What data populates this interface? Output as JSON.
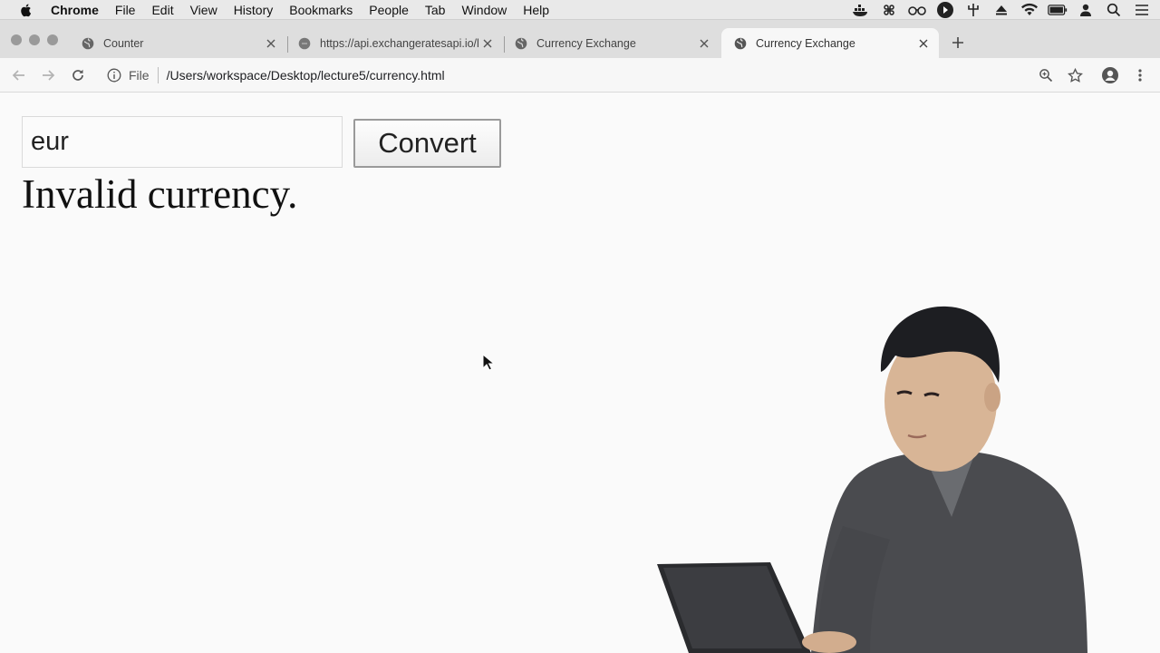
{
  "menubar": {
    "app_name": "Chrome",
    "items": [
      "File",
      "Edit",
      "View",
      "History",
      "Bookmarks",
      "People",
      "Tab",
      "Window",
      "Help"
    ]
  },
  "tabs": [
    {
      "title": "Counter",
      "favicon": "globe-icon",
      "active": false
    },
    {
      "title": "https://api.exchangeratesapi.io/l",
      "favicon": "page-icon",
      "active": false
    },
    {
      "title": "Currency Exchange",
      "favicon": "globe-icon",
      "active": false
    },
    {
      "title": "Currency Exchange",
      "favicon": "globe-icon",
      "active": true
    }
  ],
  "toolbar": {
    "scheme_label": "File",
    "url": "/Users/workspace/Desktop/lecture5/currency.html"
  },
  "page": {
    "input_value": "eur",
    "convert_label": "Convert",
    "result_text": "Invalid currency."
  },
  "colors": {
    "page_background": "#fafafa",
    "tabstrip_background": "#dedede",
    "toolbar_background": "#f7f7f7"
  }
}
